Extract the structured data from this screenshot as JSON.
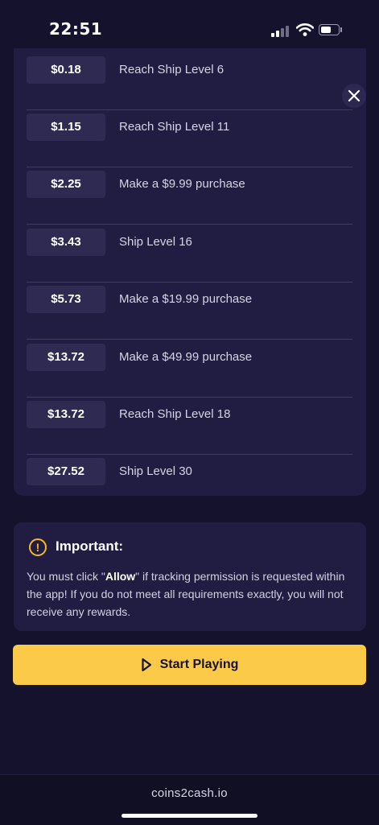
{
  "status_bar": {
    "time": "22:51"
  },
  "rewards": [
    {
      "amount": "$0.18",
      "task": "Reach Ship Level 6"
    },
    {
      "amount": "$1.15",
      "task": "Reach Ship Level 11"
    },
    {
      "amount": "$2.25",
      "task": "Make a $9.99 purchase"
    },
    {
      "amount": "$3.43",
      "task": "Ship Level 16"
    },
    {
      "amount": "$5.73",
      "task": "Make a $19.99 purchase"
    },
    {
      "amount": "$13.72",
      "task": "Make a $49.99 purchase"
    },
    {
      "amount": "$13.72",
      "task": "Reach Ship Level 18"
    },
    {
      "amount": "$27.52",
      "task": "Ship Level 30"
    }
  ],
  "important": {
    "icon": "!",
    "title": "Important:",
    "text_before": "You must click \"",
    "text_emphasis": "Allow",
    "text_after": "\" if tracking permission is requested within the app! If you do not meet all requirements exactly, you will not receive any rewards."
  },
  "start_button": {
    "label": "Start Playing"
  },
  "footer": {
    "domain": "coins2cash.io"
  },
  "colors": {
    "background": "#15122d",
    "card": "#211d42",
    "accent": "#fcca49",
    "warning": "#f5b829"
  }
}
